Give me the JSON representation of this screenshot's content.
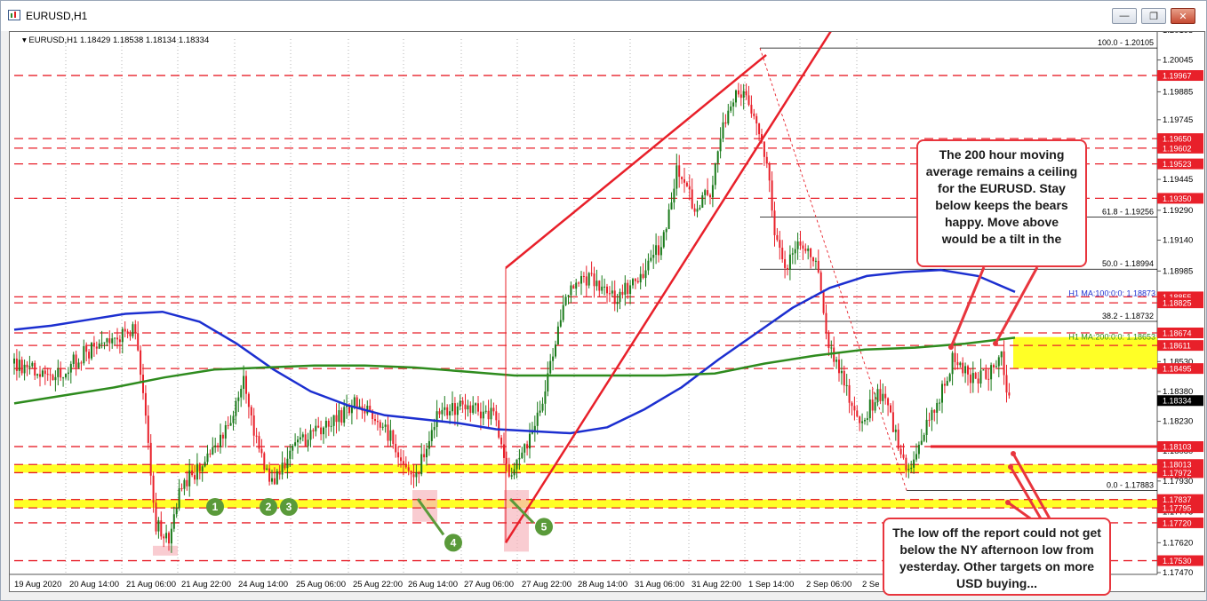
{
  "window": {
    "title": "EURUSD,H1",
    "buttons": {
      "minimize": "minimize-icon",
      "restore": "restore-icon",
      "close": "close-icon"
    }
  },
  "chart_header": "EURUSD,H1  1.18429 1.18538 1.18134 1.18334",
  "colors": {
    "bull": "#1a7a1a",
    "bear": "#e8202a",
    "ma200": "#2e8b1e",
    "ma100": "#1c2fd0",
    "zone": "#ffff00",
    "level": "#e8202a",
    "callout_border": "#e8353d"
  },
  "price_axis": {
    "min": 1.1747,
    "max": 1.2015,
    "ticks": [
      "1.20195",
      "1.20045",
      "1.19885",
      "1.19745",
      "1.19595",
      "1.19445",
      "1.19290",
      "1.19140",
      "1.18985",
      "1.18835",
      "1.18530",
      "1.18380",
      "1.18230",
      "1.18080",
      "1.17930",
      "1.17775",
      "1.17620",
      "1.17470"
    ]
  },
  "time_axis": {
    "labels": [
      "19 Aug 2020",
      "20 Aug 14:00",
      "21 Aug 06:00",
      "21 Aug 22:00",
      "24 Aug 14:00",
      "25 Aug 06:00",
      "25 Aug 22:00",
      "26 Aug 14:00",
      "27 Aug 06:00",
      "27 Aug 22:00",
      "28 Aug 14:00",
      "31 Aug 06:00",
      "31 Aug 22:00",
      "1 Sep 14:00",
      "2 Sep 06:00",
      "2 Se"
    ]
  },
  "red_level_tags": [
    "1.19967",
    "1.19650",
    "1.19602",
    "1.19523",
    "1.19350",
    "1.18855",
    "1.18825",
    "1.18674",
    "1.18611",
    "1.18495",
    "1.18103",
    "1.18013",
    "1.17972",
    "1.17837",
    "1.17795",
    "1.17720",
    "1.17530"
  ],
  "current_price_tag": "1.18334",
  "fib_labels": [
    "100.0 - 1.20105",
    "61.8 - 1.19256",
    "50.0 - 1.18994",
    "38.2 - 1.18732",
    "0.0 - 1.17883"
  ],
  "ma_labels": {
    "ma100": "H1 MA:100:0:0: 1.18873",
    "ma200": "H1 MA:200:0:0: 1.18653"
  },
  "swing_markers": [
    "1",
    "2",
    "3",
    "4",
    "5"
  ],
  "callouts": {
    "top": "The 200 hour moving average remains a ceiling for the EURUSD.  Stay below keeps the bears happy. Move above would be a tilt in the",
    "bottom": "The low off the report could not get below the NY afternoon low from yesterday. Other targets on more USD buying..."
  },
  "chart_data": {
    "type": "line",
    "title": "",
    "xlabel": "",
    "ylabel": "",
    "ylim": [
      1.1747,
      1.2015
    ],
    "series": [
      {
        "name": "H1 MA:100:0:0",
        "values": [
          1.1869,
          1.1871,
          1.1874,
          1.1877,
          1.1878,
          1.1873,
          1.1862,
          1.1849,
          1.1838,
          1.1831,
          1.1826,
          1.1824,
          1.1822,
          1.1819,
          1.1818,
          1.1817,
          1.182,
          1.1829,
          1.184,
          1.1854,
          1.1867,
          1.188,
          1.189,
          1.1896,
          1.1898,
          1.1899,
          1.1896,
          1.1888
        ]
      },
      {
        "name": "H1 MA:200:0:0",
        "values": [
          1.1832,
          1.1836,
          1.184,
          1.1845,
          1.1849,
          1.185,
          1.1851,
          1.1851,
          1.185,
          1.1848,
          1.1846,
          1.1846,
          1.1846,
          1.1846,
          1.1847,
          1.1852,
          1.1856,
          1.1859,
          1.186,
          1.1862,
          1.1865
        ]
      }
    ]
  }
}
